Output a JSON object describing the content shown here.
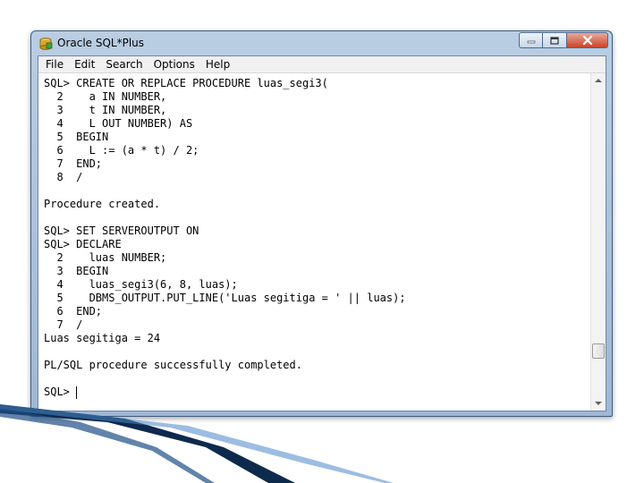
{
  "window": {
    "title": "Oracle SQL*Plus"
  },
  "menu": {
    "items": [
      "File",
      "Edit",
      "Search",
      "Options",
      "Help"
    ]
  },
  "terminal": {
    "lines": [
      "SQL> CREATE OR REPLACE PROCEDURE luas_segi3(",
      "  2    a IN NUMBER,",
      "  3    t IN NUMBER,",
      "  4    L OUT NUMBER) AS",
      "  5  BEGIN",
      "  6    L := (a * t) / 2;",
      "  7  END;",
      "  8  /",
      "",
      "Procedure created.",
      "",
      "SQL> SET SERVEROUTPUT ON",
      "SQL> DECLARE",
      "  2    luas NUMBER;",
      "  3  BEGIN",
      "  4    luas_segi3(6, 8, luas);",
      "  5    DBMS_OUTPUT.PUT_LINE('Luas segitiga = ' || luas);",
      "  6  END;",
      "  7  /",
      "Luas segitiga = 24",
      "",
      "PL/SQL procedure successfully completed.",
      "",
      "SQL> "
    ]
  },
  "colors": {
    "titlebar": "#b9cde3",
    "close_button": "#c9442c",
    "slide_accent_dark": "#0d2a4d",
    "slide_accent_light": "#4a86c8"
  }
}
